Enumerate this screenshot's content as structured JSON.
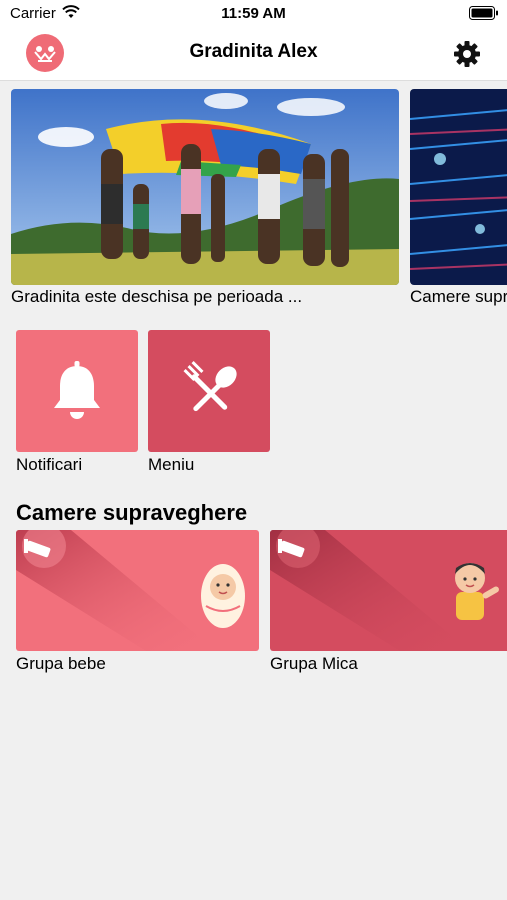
{
  "status_bar": {
    "carrier": "Carrier",
    "time": "11:59 AM"
  },
  "header": {
    "title": "Gradinita Alex",
    "logo_icon": "kids-logo-icon",
    "settings_icon": "gear-icon"
  },
  "banners": [
    {
      "caption": "Gradinita este deschisa pe perioada ..."
    },
    {
      "caption": "Camere supraveghere"
    }
  ],
  "tiles": [
    {
      "label": "Notificari",
      "icon": "bell-icon",
      "color": "#f2707c"
    },
    {
      "label": "Meniu",
      "icon": "fork-spoon-icon",
      "color": "#d44c5f"
    }
  ],
  "cameras": {
    "section_title": "Camere supraveghere",
    "items": [
      {
        "label": "Grupa bebe",
        "color": "#f2707c"
      },
      {
        "label": "Grupa Mica",
        "color": "#d44c5f"
      }
    ]
  }
}
